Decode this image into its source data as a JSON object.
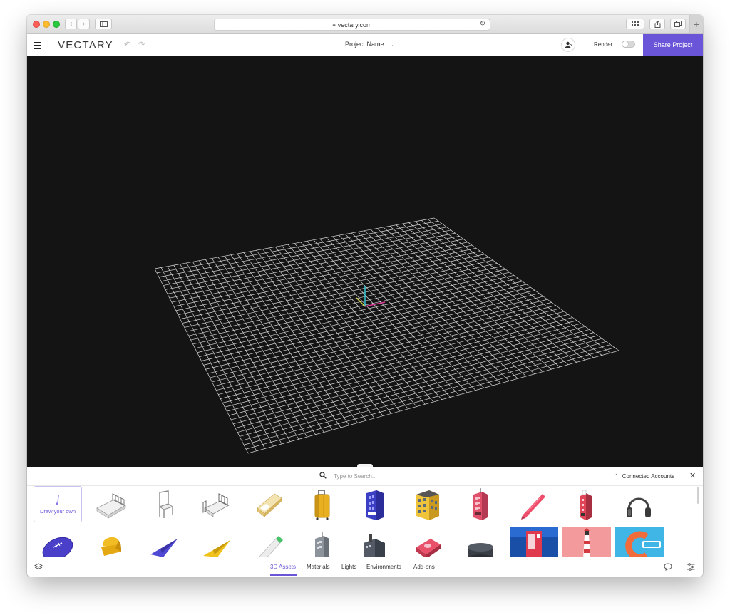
{
  "browser": {
    "url": "vectary.com"
  },
  "header": {
    "logo": "VECTARY",
    "project_name": "Project Name",
    "render_label": "Render",
    "share_label": "Share Project"
  },
  "search": {
    "placeholder": "Type to Search...",
    "connected_label": "Connected Accounts"
  },
  "assets": {
    "draw_own_label": "Draw your own",
    "items_row1": [
      "bed-icon",
      "chair-icon",
      "single-bed-icon",
      "mattress-icon",
      "suitcase-icon",
      "blue-building-icon",
      "yellow-building-icon",
      "red-building-icon",
      "pen-icon",
      "red-tower-icon",
      "headphones-icon"
    ],
    "items_row2": [
      "football-icon",
      "yellow-chair-icon",
      "paper-plane-blue-icon",
      "paper-plane-yellow-icon",
      "marker-icon",
      "grey-building-icon",
      "dark-building-icon",
      "sharpener-icon",
      "cylinder-icon",
      "vending-machine-thumbnail",
      "lighthouse-thumbnail",
      "c-logo-thumbnail"
    ]
  },
  "tabs": [
    {
      "label": "3D Assets",
      "active": true
    },
    {
      "label": "Materials",
      "active": false
    },
    {
      "label": "Lights",
      "active": false
    },
    {
      "label": "Environments",
      "active": false
    },
    {
      "label": "Add-ons",
      "active": false
    }
  ],
  "colors": {
    "accent": "#6a55d8",
    "viewport_bg": "#141414"
  }
}
